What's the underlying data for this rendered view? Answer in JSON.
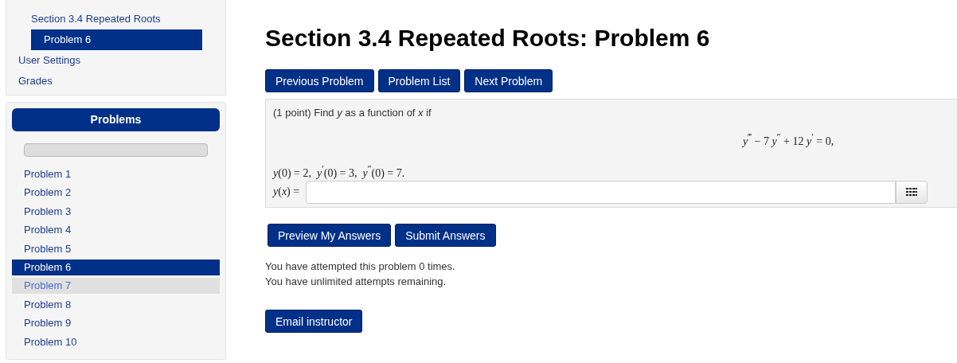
{
  "nav": {
    "section": "Section 3.4 Repeated Roots",
    "current": "Problem 6",
    "items": [
      "User Settings",
      "Grades"
    ]
  },
  "problems_panel": {
    "title": "Problems",
    "progress": {
      "level": 0
    },
    "problems": [
      {
        "label": "Problem 1",
        "selected": false,
        "highlighted": false
      },
      {
        "label": "Problem 2",
        "selected": false,
        "highlighted": false
      },
      {
        "label": "Problem 3",
        "selected": false,
        "highlighted": false
      },
      {
        "label": "Problem 4",
        "selected": false,
        "highlighted": false
      },
      {
        "label": "Problem 5",
        "selected": false,
        "highlighted": false
      },
      {
        "label": "Problem 6",
        "selected": true,
        "highlighted": false
      },
      {
        "label": "Problem 7",
        "selected": false,
        "highlighted": true
      },
      {
        "label": "Problem 8",
        "selected": false,
        "highlighted": false
      },
      {
        "label": "Problem 9",
        "selected": false,
        "highlighted": false
      },
      {
        "label": "Problem 10",
        "selected": false,
        "highlighted": false
      }
    ]
  },
  "title": "Section 3.4 Repeated Roots: Problem 6",
  "nav_buttons": [
    "Previous Problem",
    "Problem List",
    "Next Problem"
  ],
  "problem": {
    "statement": "(1 point) Find *y* as a function of *x* if",
    "equation": "*y*$^{‴}$ − 7 *y*$^{″}$ + 12 *y*$^{′}$ = 0,",
    "conditions": "*y*(0) = 2,  *y*$^{′}$(0) = 3,  *y*$^{″}$(0) = 7.",
    "answer_label": "*y*(*x*) ="
  },
  "submit_buttons": [
    "Preview My Answers",
    "Submit Answers"
  ],
  "messages": [
    "You have attempted this problem 0 times.",
    "You have unlimited attempts remaining."
  ],
  "email_button": "Email instructor"
}
